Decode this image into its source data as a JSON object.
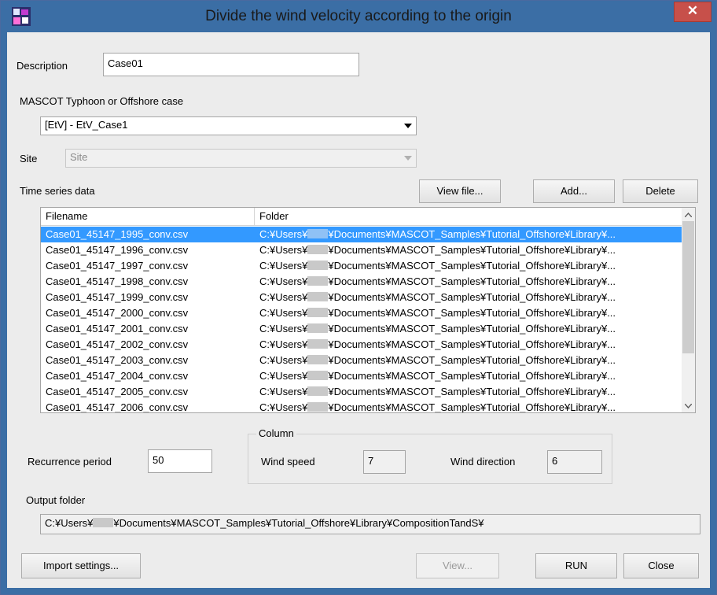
{
  "window": {
    "title": "Divide the wind velocity according to the origin",
    "close_glyph": "✕"
  },
  "description": {
    "label": "Description",
    "value": "Case01"
  },
  "case": {
    "label": "MASCOT Typhoon or Offshore case",
    "value": "[EtV] - EtV_Case1"
  },
  "site": {
    "label": "Site",
    "value": "Site"
  },
  "timeseries": {
    "label": "Time series data",
    "view_button": "View file...",
    "add_button": "Add...",
    "delete_button": "Delete",
    "columns": [
      "Filename",
      "Folder"
    ],
    "folder_prefix": "C:¥Users¥",
    "rows": [
      {
        "filename": "Case01_45147_1995_conv.csv",
        "folder": "¥Documents¥MASCOT_Samples¥Tutorial_Offshore¥Library¥...",
        "selected": true
      },
      {
        "filename": "Case01_45147_1996_conv.csv",
        "folder": "¥Documents¥MASCOT_Samples¥Tutorial_Offshore¥Library¥...",
        "selected": false
      },
      {
        "filename": "Case01_45147_1997_conv.csv",
        "folder": "¥Documents¥MASCOT_Samples¥Tutorial_Offshore¥Library¥...",
        "selected": false
      },
      {
        "filename": "Case01_45147_1998_conv.csv",
        "folder": "¥Documents¥MASCOT_Samples¥Tutorial_Offshore¥Library¥...",
        "selected": false
      },
      {
        "filename": "Case01_45147_1999_conv.csv",
        "folder": "¥Documents¥MASCOT_Samples¥Tutorial_Offshore¥Library¥...",
        "selected": false
      },
      {
        "filename": "Case01_45147_2000_conv.csv",
        "folder": "¥Documents¥MASCOT_Samples¥Tutorial_Offshore¥Library¥...",
        "selected": false
      },
      {
        "filename": "Case01_45147_2001_conv.csv",
        "folder": "¥Documents¥MASCOT_Samples¥Tutorial_Offshore¥Library¥...",
        "selected": false
      },
      {
        "filename": "Case01_45147_2002_conv.csv",
        "folder": "¥Documents¥MASCOT_Samples¥Tutorial_Offshore¥Library¥...",
        "selected": false
      },
      {
        "filename": "Case01_45147_2003_conv.csv",
        "folder": "¥Documents¥MASCOT_Samples¥Tutorial_Offshore¥Library¥...",
        "selected": false
      },
      {
        "filename": "Case01_45147_2004_conv.csv",
        "folder": "¥Documents¥MASCOT_Samples¥Tutorial_Offshore¥Library¥...",
        "selected": false
      },
      {
        "filename": "Case01_45147_2005_conv.csv",
        "folder": "¥Documents¥MASCOT_Samples¥Tutorial_Offshore¥Library¥...",
        "selected": false
      },
      {
        "filename": "Case01_45147_2006_conv.csv",
        "folder": "¥Documents¥MASCOT_Samples¥Tutorial_Offshore¥Library¥...",
        "selected": false
      }
    ]
  },
  "recurrence": {
    "label": "Recurrence period",
    "value": "50"
  },
  "column": {
    "title": "Column",
    "wind_speed_label": "Wind speed",
    "wind_speed_value": "7",
    "wind_direction_label": "Wind direction",
    "wind_direction_value": "6"
  },
  "output": {
    "label": "Output folder",
    "prefix": "C:¥Users¥",
    "suffix": "¥Documents¥MASCOT_Samples¥Tutorial_Offshore¥Library¥CompositionTandS¥"
  },
  "footer": {
    "import_button": "Import settings...",
    "view_button": "View...",
    "run_button": "RUN",
    "close_button": "Close"
  },
  "icons": {
    "app": "app-icon",
    "close": "close-icon",
    "dropdown": "chevron-down-icon",
    "scroll_up": "chevron-up-icon",
    "scroll_down": "chevron-down-icon"
  },
  "colors": {
    "titlebar": "#3b6ea5",
    "close": "#c7504a",
    "selection": "#3399ff"
  }
}
